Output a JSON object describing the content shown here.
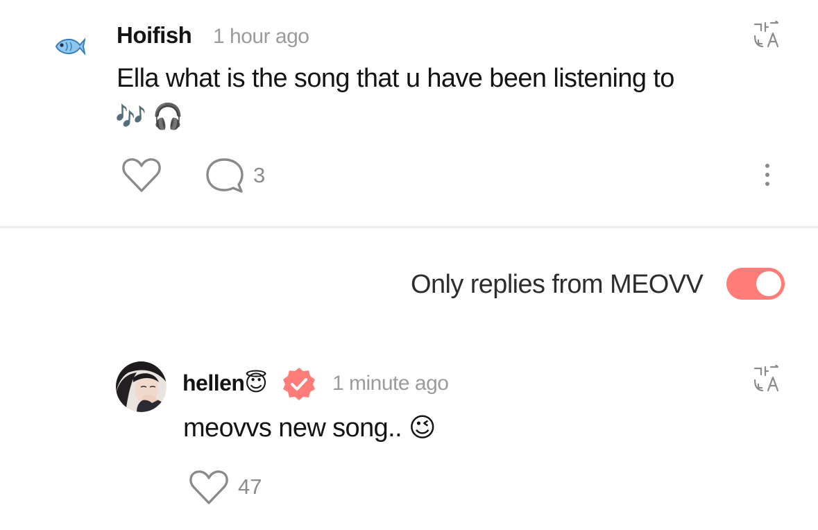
{
  "post": {
    "author": "Hoifish",
    "avatar_icon": "fish-icon",
    "timestamp": "1 hour ago",
    "text": "Ella what is the song that u have been listening to",
    "emoji_line": "🎶 🎧",
    "translate_icon": "translate-icon",
    "like_icon": "heart-icon",
    "comment_icon": "speech-bubble-icon",
    "comment_count": "3",
    "more_icon": "more-vertical-icon"
  },
  "filter": {
    "label": "Only replies from MEOVV",
    "toggle_on": true,
    "toggle_color": "#ff7c78"
  },
  "reply": {
    "author": "hellen😇",
    "verified_icon": "verified-badge-icon",
    "verified_color": "#ff7c78",
    "timestamp": "1 minute ago",
    "text": "meovvs new song.. 😉",
    "like_count": "47",
    "translate_icon": "translate-icon"
  }
}
